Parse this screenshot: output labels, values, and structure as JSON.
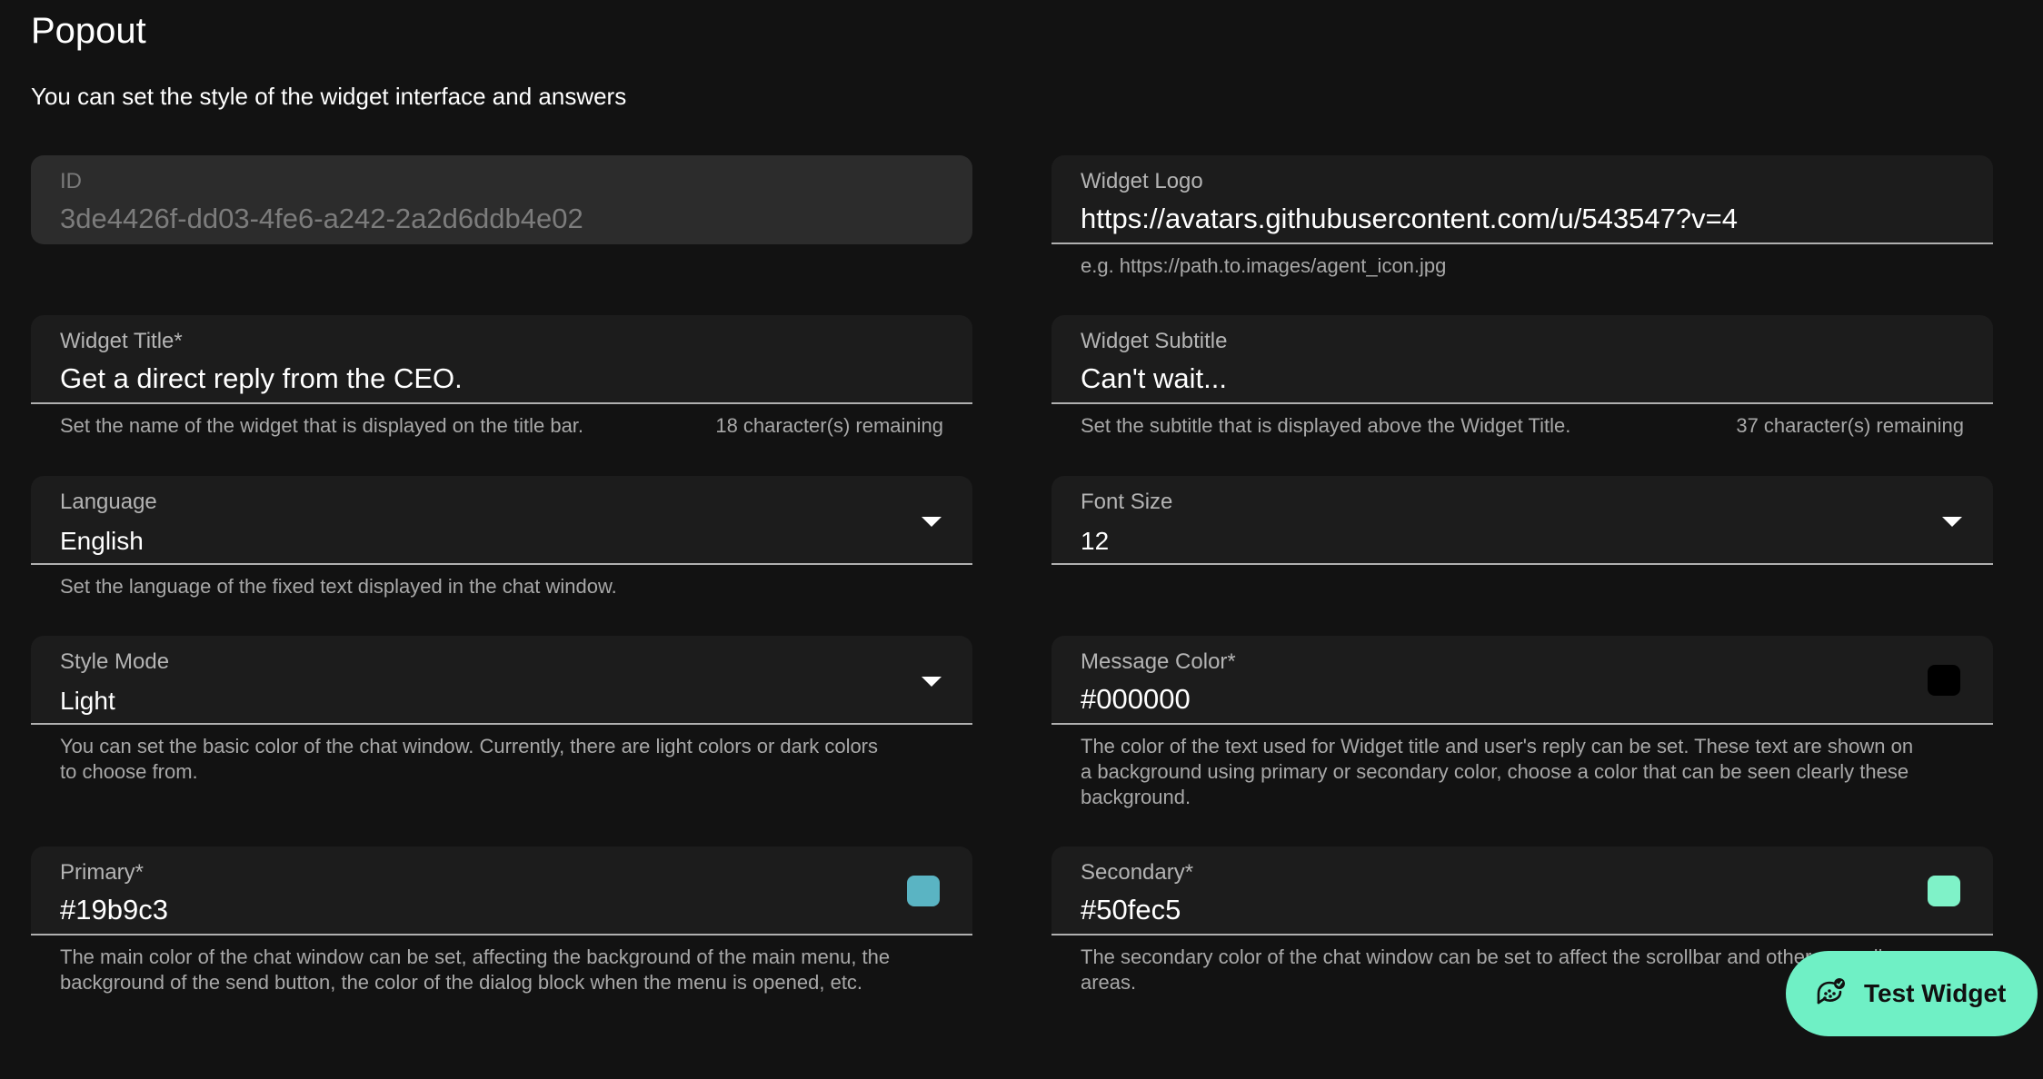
{
  "page": {
    "title": "Popout",
    "subtitle": "You can set the style of the widget interface and answers"
  },
  "fields": {
    "id": {
      "label": "ID",
      "value": "3de4426f-dd03-4fe6-a242-2a2d6ddb4e02"
    },
    "widget_logo": {
      "label": "Widget Logo",
      "value": "https://avatars.githubusercontent.com/u/543547?v=4",
      "helper": "e.g. https://path.to.images/agent_icon.jpg"
    },
    "widget_title": {
      "label": "Widget Title",
      "required_mark": "*",
      "value": "Get a direct reply from the CEO.",
      "helper": "Set the name of the widget that is displayed on the title bar.",
      "counter": "18 character(s) remaining"
    },
    "widget_subtitle": {
      "label": "Widget Subtitle",
      "value": "Can't wait...",
      "helper": "Set the subtitle that is displayed above the Widget Title.",
      "counter": "37 character(s) remaining"
    },
    "language": {
      "label": "Language",
      "value": "English",
      "helper": "Set the language of the fixed text displayed in the chat window."
    },
    "font_size": {
      "label": "Font Size",
      "value": "12"
    },
    "style_mode": {
      "label": "Style Mode",
      "value": "Light",
      "helper": "You can set the basic color of the chat window. Currently, there are light colors or dark colors to choose from."
    },
    "message_color": {
      "label": "Message Color",
      "required_mark": "*",
      "value": "#000000",
      "swatch_color": "#000000",
      "helper": "The color of the text used for Widget title and user's reply can be set. These text are shown on a background using primary or secondary color, choose a color that can be seen clearly these background."
    },
    "primary": {
      "label": "Primary",
      "required_mark": "*",
      "value": "#19b9c3",
      "swatch_color": "#5ab4c3",
      "helper": "The main color of the chat window can be set, affecting the background of the main menu, the background of the send button, the color of the dialog block when the menu is opened, etc."
    },
    "secondary": {
      "label": "Secondary",
      "required_mark": "*",
      "value": "#50fec5",
      "swatch_color": "#7ff2c8",
      "helper": "The secondary color of the chat window can be set to affect the scrollbar and other sporadic areas."
    }
  },
  "test_widget": {
    "label": "Test Widget",
    "icon": "widget-chat-icon",
    "color": "#6ff0c5"
  }
}
